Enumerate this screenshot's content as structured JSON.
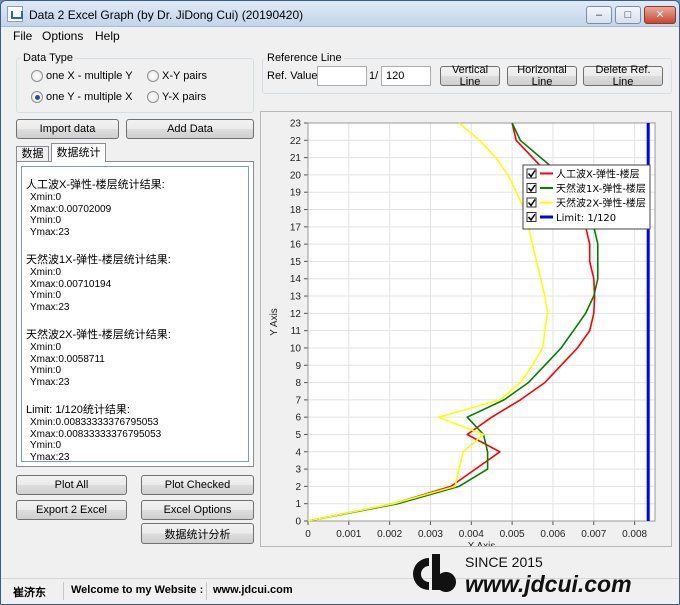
{
  "window": {
    "title": "Data 2 Excel Graph (by Dr. JiDong Cui) (20190420)",
    "controls": [
      "–",
      "□",
      "✕"
    ]
  },
  "menu": [
    "File",
    "Options",
    "Help"
  ],
  "data_type": {
    "title": "Data Type",
    "options": [
      {
        "label": "one X  - multiple Y",
        "checked": false
      },
      {
        "label": "X-Y pairs",
        "checked": false
      },
      {
        "label": "one Y  - multiple X",
        "checked": true
      },
      {
        "label": "Y-X pairs",
        "checked": false
      }
    ]
  },
  "reference_line": {
    "title": "Reference Line",
    "ref_value_label": "Ref. Value",
    "ref_value": "",
    "ratio_prefix": "1/",
    "ratio_value": "120",
    "vertical_btn": "Vertical Line",
    "horizontal_btn": "Horizontal Line",
    "delete_btn": "Delete Ref. Line"
  },
  "buttons": {
    "import": "Import data",
    "add": "Add Data",
    "plot_all": "Plot All",
    "plot_checked": "Plot Checked",
    "export": "Export 2 Excel",
    "excel_options": "Excel Options",
    "stat_analysis": "数据统计分析"
  },
  "tabs": [
    "数据",
    "数据统计"
  ],
  "stats": [
    {
      "title": "人工波X-弹性-楼层统计结果:",
      "lines": [
        "Xmin:0",
        "Xmax:0.00702009",
        "Ymin:0",
        "Ymax:23"
      ]
    },
    {
      "title": "天然波1X-弹性-楼层统计结果:",
      "lines": [
        "Xmin:0",
        "Xmax:0.00710194",
        "Ymin:0",
        "Ymax:23"
      ]
    },
    {
      "title": "天然波2X-弹性-楼层统计结果:",
      "lines": [
        "Xmin:0",
        "Xmax:0.0058711",
        "Ymin:0",
        "Ymax:23"
      ]
    },
    {
      "title": "Limit: 1/120统计结果:",
      "lines": [
        "Xmin:0.00833333376795053",
        "Xmax:0.00833333376795053",
        "Ymin:0",
        "Ymax:23"
      ]
    }
  ],
  "chart_data": {
    "type": "line",
    "xlabel": "X Axis",
    "ylabel": "Y Axis",
    "xlim": [
      0,
      0.0085
    ],
    "ylim": [
      0,
      23
    ],
    "x_ticks": [
      "0",
      "0.001",
      "0.002",
      "0.003",
      "0.004",
      "0.005",
      "0.006",
      "0.007",
      "0.008"
    ],
    "y_ticks": [
      "0",
      "1",
      "2",
      "3",
      "4",
      "5",
      "6",
      "7",
      "8",
      "9",
      "10",
      "11",
      "12",
      "13",
      "14",
      "15",
      "16",
      "17",
      "18",
      "19",
      "20",
      "21",
      "22",
      "23"
    ],
    "grid": true,
    "legend_position": "top-right",
    "series": [
      {
        "name": "人工波X-弹性-楼层",
        "color": "#ff0000",
        "x": [
          0,
          0.0021,
          0.0035,
          0.0041,
          0.0047,
          0.0039,
          0.0045,
          0.0052,
          0.0058,
          0.0062,
          0.0066,
          0.0069,
          0.007,
          0.00702,
          0.007,
          0.0069,
          0.0069,
          0.0068,
          0.0066,
          0.0063,
          0.0059,
          0.0055,
          0.0051,
          0.005
        ],
        "y": [
          0,
          1,
          2,
          3,
          4,
          5,
          6,
          7,
          8,
          9,
          10,
          11,
          12,
          13,
          14,
          15,
          16,
          17,
          18,
          19,
          20,
          21,
          22,
          23
        ]
      },
      {
        "name": "天然波1X-弹性-楼层",
        "color": "#008000",
        "x": [
          0,
          0.0022,
          0.0037,
          0.0044,
          0.0044,
          0.0043,
          0.0039,
          0.0048,
          0.0054,
          0.0058,
          0.0062,
          0.0065,
          0.0068,
          0.007,
          0.0071,
          0.0071,
          0.0071,
          0.007,
          0.0068,
          0.0066,
          0.0062,
          0.0057,
          0.0052,
          0.005
        ],
        "y": [
          0,
          1,
          2,
          3,
          4,
          5,
          6,
          7,
          8,
          9,
          10,
          11,
          12,
          13,
          14,
          15,
          16,
          17,
          18,
          19,
          20,
          21,
          22,
          23
        ]
      },
      {
        "name": "天然波2X-弹性-楼层",
        "color": "#ffff00",
        "x": [
          0,
          0.0021,
          0.0036,
          0.0037,
          0.0038,
          0.0043,
          0.0032,
          0.0047,
          0.0052,
          0.0055,
          0.00575,
          0.0058,
          0.00587,
          0.0058,
          0.0057,
          0.0056,
          0.0055,
          0.0054,
          0.0053,
          0.0051,
          0.0049,
          0.0046,
          0.0042,
          0.0037
        ],
        "y": [
          0,
          1,
          2,
          3,
          4,
          5,
          6,
          7,
          8,
          9,
          10,
          11,
          12,
          13,
          14,
          15,
          16,
          17,
          18,
          19,
          20,
          21,
          22,
          23
        ]
      },
      {
        "name": "Limit: 1/120",
        "color": "#0000ff",
        "x": [
          0.00833333376795053,
          0.00833333376795053
        ],
        "y": [
          0,
          23
        ]
      }
    ]
  },
  "status": {
    "author": "崔济东",
    "welcome": "Welcome to my Website :",
    "site": "www.jdcui.com"
  },
  "watermark": {
    "since": "SINCE 2015",
    "site": "www.jdcui.com"
  }
}
